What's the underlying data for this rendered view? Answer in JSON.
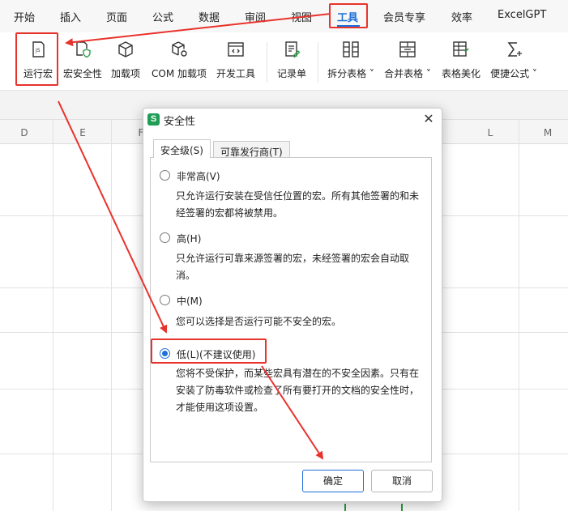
{
  "menu": {
    "tabs": [
      "开始",
      "插入",
      "页面",
      "公式",
      "数据",
      "审阅",
      "视图",
      "工具",
      "会员专享",
      "效率",
      "ExcelGPT"
    ],
    "active": "工具"
  },
  "ribbon": {
    "items": [
      "运行宏",
      "宏安全性",
      "加载项",
      "COM 加载项",
      "开发工具",
      "记录单",
      "拆分表格",
      "合并表格",
      "表格美化",
      "便捷公式"
    ]
  },
  "sheet": {
    "columns": [
      "D",
      "E",
      "F",
      "L",
      "M"
    ]
  },
  "dialog": {
    "title": "安全性",
    "tabs": [
      "安全级(S)",
      "可靠发行商(T)"
    ],
    "options": [
      {
        "label": "非常高(V)",
        "desc": "只允许运行安装在受信任位置的宏。所有其他签署的和未经签署的宏都将被禁用。",
        "checked": false
      },
      {
        "label": "高(H)",
        "desc": "只允许运行可靠来源签署的宏，未经签署的宏会自动取消。",
        "checked": false
      },
      {
        "label": "中(M)",
        "desc": "您可以选择是否运行可能不安全的宏。",
        "checked": false
      },
      {
        "label": "低(L)(不建议使用)",
        "desc": "您将不受保护，而某些宏具有潜在的不安全因素。只有在安装了防毒软件或检查了所有要打开的文档的安全性时，才能使用这项设置。",
        "checked": true
      }
    ],
    "ok_label": "确定",
    "cancel_label": "取消"
  },
  "colors": {
    "accent": "#1e6fd9",
    "annotation": "#e8322c",
    "excel_green": "#1f9d55"
  }
}
